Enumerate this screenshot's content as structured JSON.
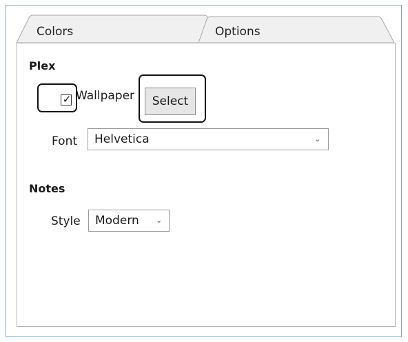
{
  "tabs": [
    {
      "label": "Colors",
      "selected": false
    },
    {
      "label": "Options",
      "selected": true
    }
  ],
  "plex": {
    "title": "Plex",
    "wallpaper": {
      "label": "Wallpaper",
      "checked": true,
      "check_glyph": "✓"
    },
    "select_button": "Select",
    "font": {
      "label": "Font",
      "value": "Helvetica",
      "chevron": "⌄"
    }
  },
  "notes": {
    "title": "Notes",
    "style": {
      "label": "Style",
      "value": "Modern",
      "chevron": "⌄"
    }
  },
  "colors": {
    "frame_border": "#7fa7d6",
    "tab_bg": "#f0f0f0",
    "button_bg": "#e6e6e6"
  }
}
